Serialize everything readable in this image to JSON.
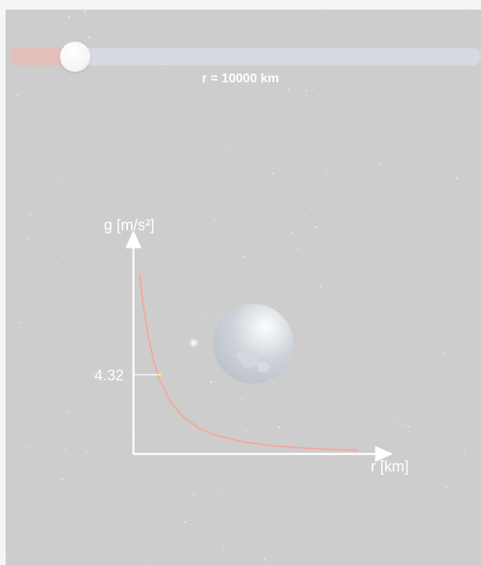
{
  "slider": {
    "value_fraction": 0.14
  },
  "readout": {
    "radius_text": "r = 10000 km"
  },
  "chart_data": {
    "type": "line",
    "xlabel": "r [km]",
    "ylabel": "g [m/s²]",
    "marked_point": {
      "r": 10000,
      "g": 4.32,
      "label": "4.32"
    },
    "series": [
      {
        "values_note_free": true,
        "x": [
          6400,
          7000,
          8000,
          9000,
          10000,
          12000,
          14000,
          17000,
          20000,
          25000,
          30000,
          35000,
          40000,
          45000
        ],
        "y": [
          9.8,
          8.19,
          6.27,
          4.95,
          4.0,
          2.78,
          2.04,
          1.38,
          1.0,
          0.64,
          0.44,
          0.33,
          0.25,
          0.2
        ]
      }
    ],
    "xlim": [
      5300,
      52000
    ],
    "ylim": [
      0,
      12.2
    ],
    "colors": {
      "curve": "#f3a89a",
      "axes": "#ffffff",
      "marker": "#f6e27a"
    }
  }
}
